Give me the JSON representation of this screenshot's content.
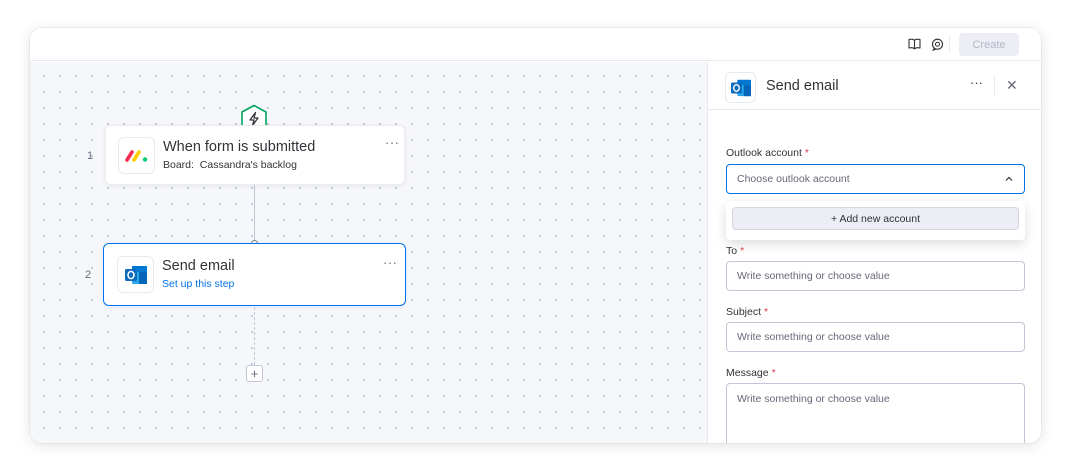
{
  "topbar": {
    "create_label": "Create",
    "icons": [
      "book-icon",
      "chat-icon"
    ]
  },
  "canvas": {
    "trigger_icon": "lightning-icon",
    "steps": [
      {
        "number": "1",
        "title": "When form is submitted",
        "subtitle_label": "Board:",
        "subtitle_value": "Cassandra's backlog",
        "app_icon": "monday-logo-icon",
        "more_label": "···"
      },
      {
        "number": "2",
        "title": "Send email",
        "subtitle": "Set up this step",
        "app_icon": "outlook-icon",
        "more_label": "···"
      }
    ],
    "add_step_label": "+"
  },
  "panel": {
    "title": "Send email",
    "app_icon": "outlook-icon",
    "more_label": "···",
    "close_label": "✕",
    "fields": {
      "outlook_account": {
        "label": "Outlook account",
        "required_mark": "*",
        "value": "Choose outlook account",
        "dropdown_action": "+ Add new account"
      },
      "to": {
        "label": "To",
        "required_mark": "*",
        "placeholder": "Write something or choose value"
      },
      "subject": {
        "label": "Subject",
        "required_mark": "*",
        "placeholder": "Write something or choose value"
      },
      "message": {
        "label": "Message",
        "required_mark": "*",
        "placeholder": "Write something or choose value"
      }
    }
  },
  "colors": {
    "accent": "#0073ea",
    "required": "#d83a52",
    "trigger_green": "#00a35c",
    "outlook_blue": "#0f6cbd"
  }
}
